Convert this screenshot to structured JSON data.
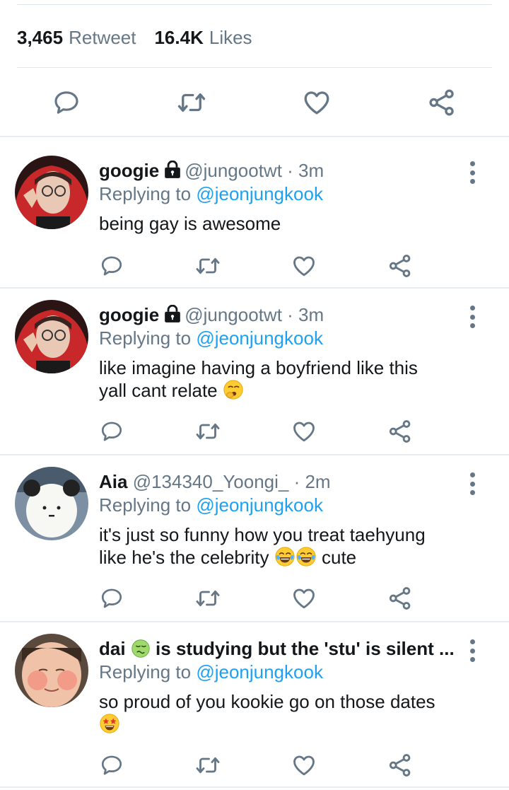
{
  "stats": {
    "retweets_count": "3,465",
    "retweets_label": "Retweet",
    "likes_count": "16.4K",
    "likes_label": "Likes"
  },
  "icons": {
    "reply": "speech-bubble-icon",
    "retweet": "retweet-arrows-icon",
    "like": "heart-outline-icon",
    "share": "share-nodes-icon",
    "more": "vertical-dots-icon",
    "protected": "lock-icon"
  },
  "colors": {
    "text": "#14171a",
    "secondary": "#657786",
    "link": "#1da1f2",
    "divider": "#e6ecf0"
  },
  "replies": [
    {
      "name": "googie",
      "handle": "@jungootwt",
      "time": "· 3m",
      "replying_label": "Replying to",
      "replying_to": "@jeonjungkook",
      "text": "being gay is awesome",
      "protected": true
    },
    {
      "name": "googie",
      "handle": "@jungootwt",
      "time": "· 3m",
      "replying_label": "Replying to",
      "replying_to": "@jeonjungkook",
      "text_line1": "like imagine having a boyfriend like this",
      "text_line2": "yall cant relate",
      "emoji": "yawning-face",
      "protected": true
    },
    {
      "name": "Aia",
      "handle": "@134340_Yoongi_",
      "time": "· 2m",
      "replying_label": "Replying to",
      "replying_to": "@jeonjungkook",
      "text_line1": "it's just so funny how you treat taehyung",
      "text_line2_before": "like he's the celebrity",
      "text_line2_after": "cute",
      "emoji": "face-with-tears-of-joy"
    },
    {
      "name_prefix": "dai",
      "name_suffix": "is studying but the 'stu' is silent ...",
      "name_emoji": "nauseated-face",
      "replying_label": "Replying to",
      "replying_to": "@jeonjungkook",
      "text": "so proud of you kookie go on those dates",
      "emoji": "star-struck"
    }
  ]
}
